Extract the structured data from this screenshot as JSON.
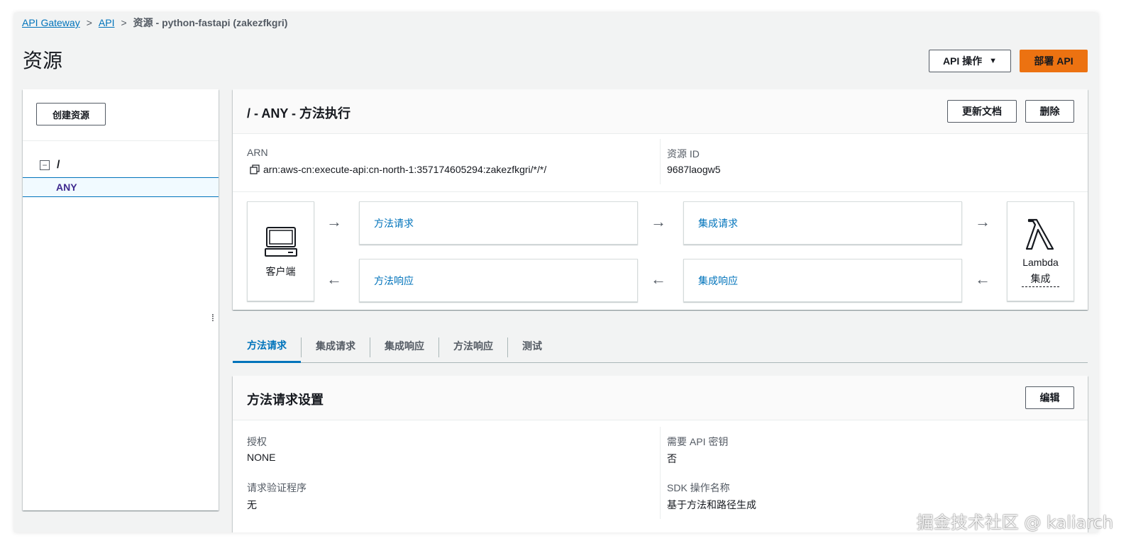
{
  "breadcrumb": {
    "api_gateway": "API Gateway",
    "api": "API",
    "current": "资源 - python-fastapi (zakezfkgri)"
  },
  "page": {
    "title": "资源",
    "api_actions_label": "API 操作",
    "deploy_label": "部署 API"
  },
  "left_panel": {
    "create_resource_label": "创建资源",
    "tree_root": "/",
    "tree_method": "ANY"
  },
  "method_execution": {
    "title": "/ - ANY - 方法执行",
    "update_docs_label": "更新文档",
    "delete_label": "删除",
    "arn_label": "ARN",
    "arn_value": "arn:aws-cn:execute-api:cn-north-1:357174605294:zakezfkgri/*/*/",
    "resource_id_label": "资源 ID",
    "resource_id_value": "9687laogw5",
    "client_label": "客户端",
    "method_request": "方法请求",
    "integration_request": "集成请求",
    "method_response": "方法响应",
    "integration_response": "集成响应",
    "lambda_label": "Lambda",
    "lambda_sub": "集成"
  },
  "tabs": [
    "方法请求",
    "集成请求",
    "集成响应",
    "方法响应",
    "测试"
  ],
  "active_tab": 0,
  "settings": {
    "title": "方法请求设置",
    "edit_label": "编辑",
    "auth_label": "授权",
    "auth_value": "NONE",
    "api_key_label": "需要 API 密钥",
    "api_key_value": "否",
    "validator_label": "请求验证程序",
    "validator_value": "无",
    "sdk_label": "SDK 操作名称",
    "sdk_value": "基于方法和路径生成"
  },
  "watermark": "掘金技术社区 @ kaliarch",
  "colors": {
    "primary_orange": "#ec7211",
    "link_blue": "#0073bb",
    "selected_purple": "#3f2a8f"
  }
}
